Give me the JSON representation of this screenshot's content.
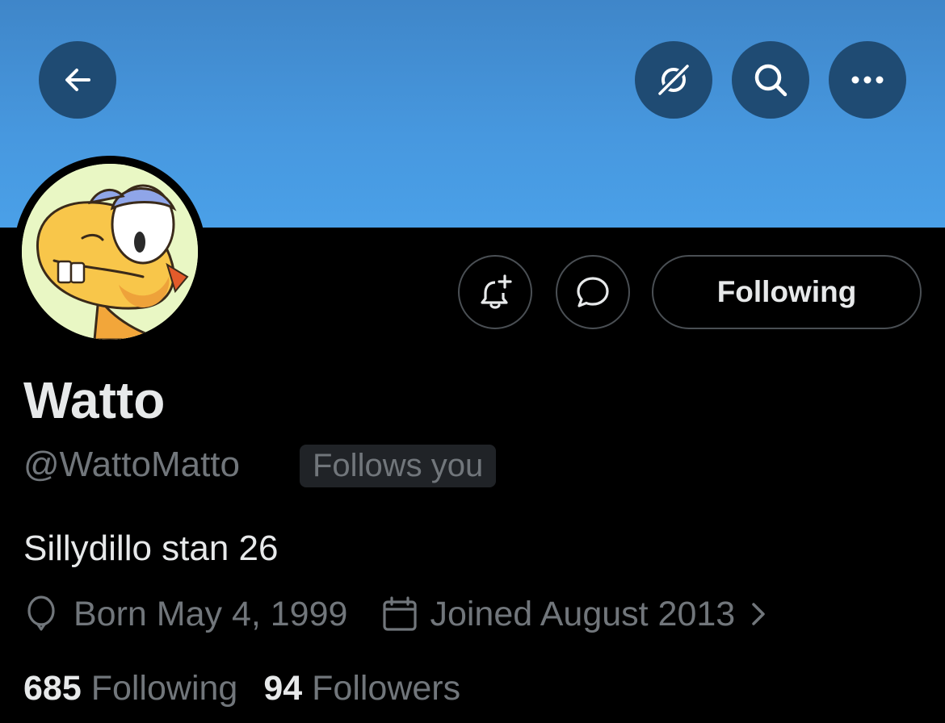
{
  "header": {
    "back_icon": "arrow-left-icon",
    "actions": [
      "translate-off-icon",
      "search-icon",
      "more-icon"
    ],
    "banner_color": "#4798df",
    "button_color": "#1f4b73"
  },
  "profile": {
    "name": "Watto",
    "handle": "@WattoMatto",
    "follows_you": "Follows you",
    "bio": "Sillydillo stan 26",
    "born": "Born May 4, 1999",
    "joined": "Joined August 2013",
    "following_button": "Following"
  },
  "stats": {
    "following_count": "685",
    "following_label": "Following",
    "followers_count": "94",
    "followers_label": "Followers"
  }
}
